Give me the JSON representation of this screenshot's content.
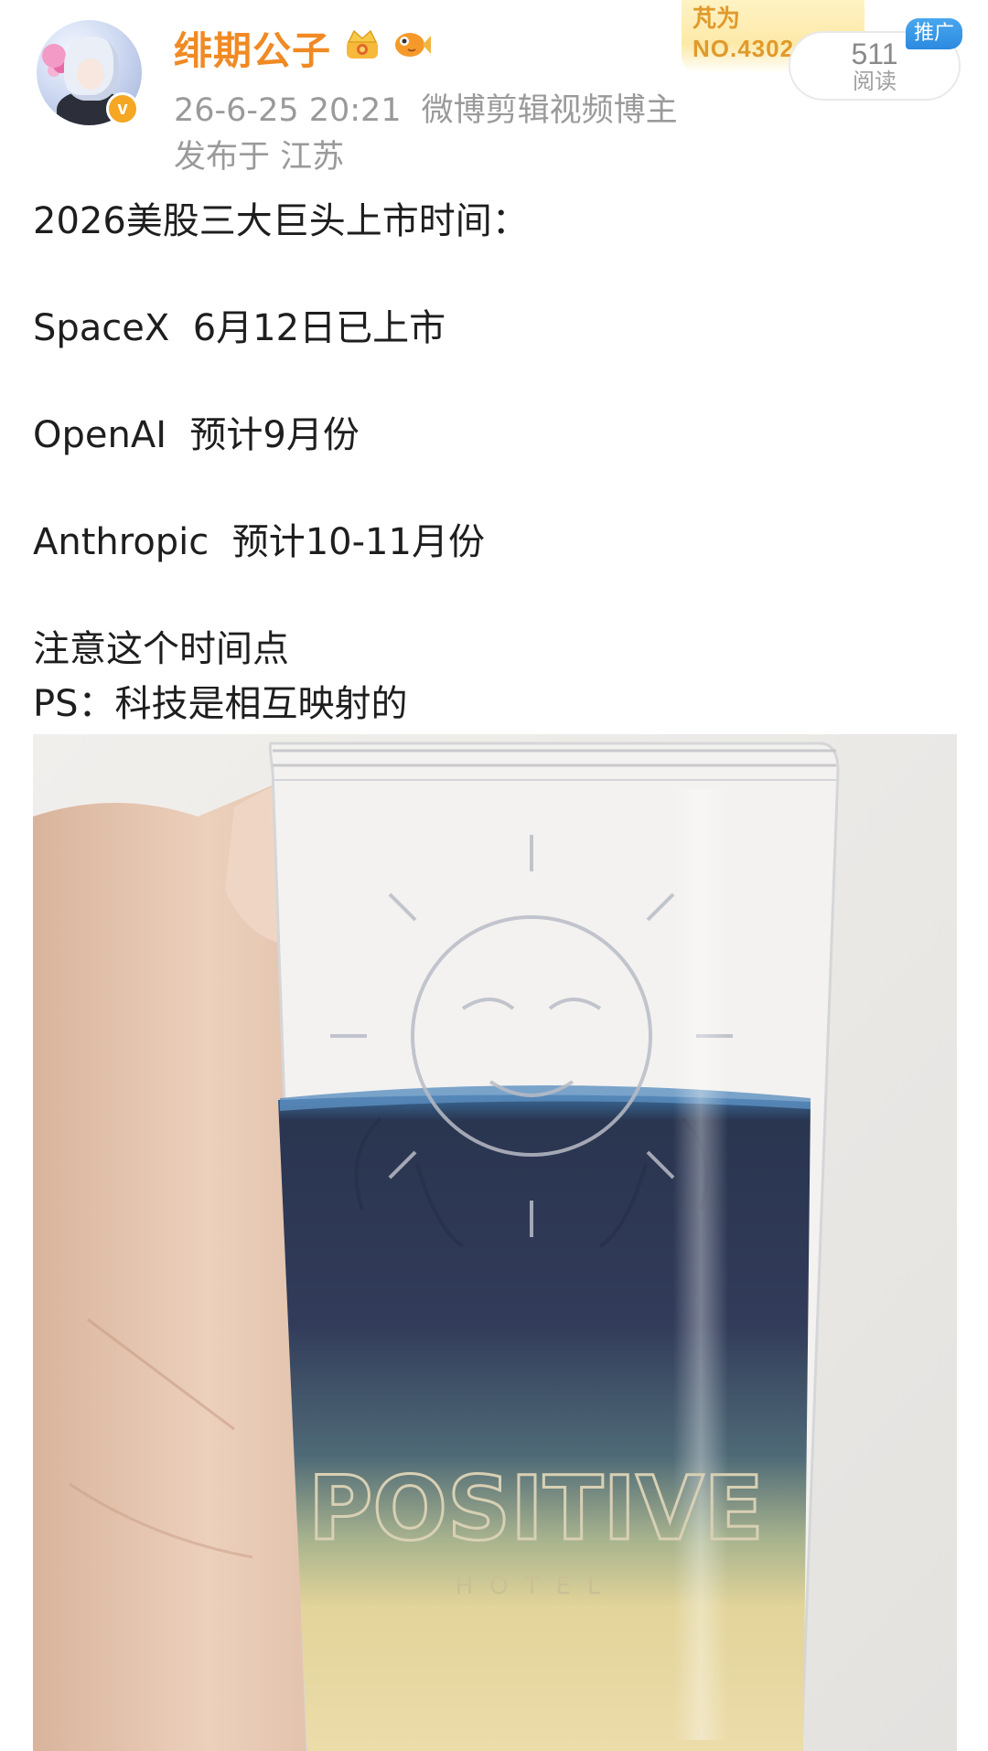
{
  "header": {
    "username": "绯期公子",
    "timestamp": "26-6-25 20:21",
    "user_tag": "微博剪辑视频博主",
    "location": "发布于 江苏",
    "rank_name": "芃为",
    "rank_number": "NO.4302",
    "read_count": "511",
    "read_label": "阅读",
    "promo_label": "推广",
    "verified_mark": "v"
  },
  "post": {
    "lines": [
      "2026美股三大巨头上市时间：",
      "SpaceX  6月12日已上市",
      "OpenAI  预计9月份",
      "Anthropic  预计10-11月份",
      "注意这个时间点",
      "PS：科技是相互映射的"
    ]
  },
  "photo": {
    "glass_text": "POSITIVE",
    "glass_subtext": "HOTEL",
    "colors": {
      "blue_layer": "#2a3550",
      "yellow_layer": "#e9d9a2",
      "skin": "#e7c9b4"
    }
  },
  "icons": [
    "verified-icon",
    "crown-badge-icon",
    "fish-badge-icon"
  ]
}
